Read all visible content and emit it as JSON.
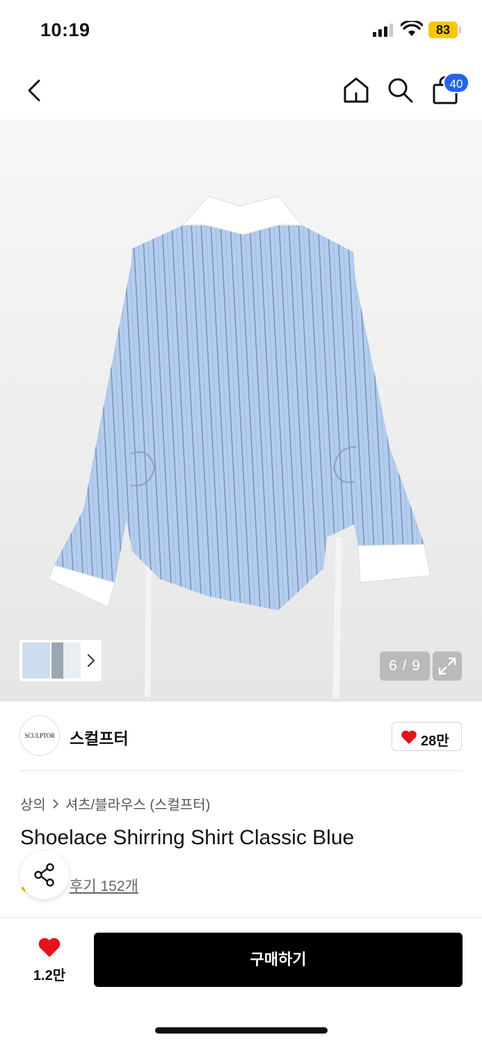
{
  "status_bar": {
    "time": "10:19",
    "battery": "83"
  },
  "nav": {
    "cart_count": "40"
  },
  "gallery": {
    "counter": "6 / 9"
  },
  "brand": {
    "logo_text": "SCULPTOR",
    "name": "스컬프터",
    "likes": "28만"
  },
  "product": {
    "breadcrumb": [
      "상의",
      "셔츠/블라우스 (스컬프터)"
    ],
    "title": "Shoelace Shirring Shirt Classic Blue",
    "reviews": "후기 152개"
  },
  "bottom_bar": {
    "wish_count": "1.2만",
    "buy_label": "구매하기"
  },
  "colors": {
    "accent_blue": "#2563eb",
    "heart_red": "#e5131d",
    "battery_yellow": "#f5c800",
    "shirt_blue": "#b3cdef"
  }
}
